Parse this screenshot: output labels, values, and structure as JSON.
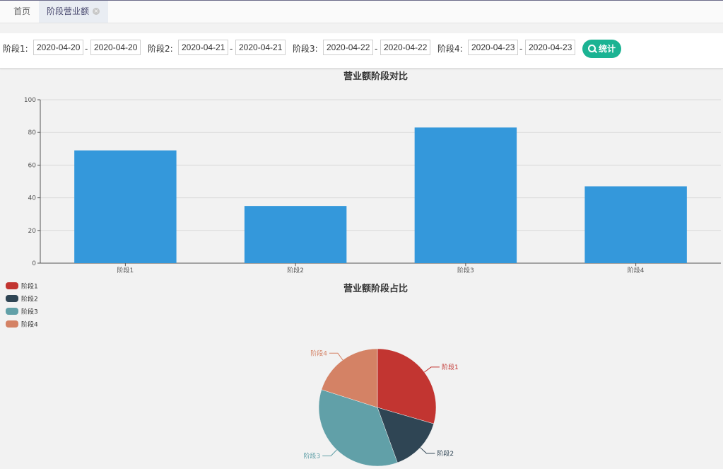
{
  "tabs": {
    "home": "首页",
    "active": "阶段营业额",
    "close_icon": "close-icon"
  },
  "filter": {
    "stages": [
      {
        "label": "阶段1:",
        "start": "2020-04-20",
        "end": "2020-04-20"
      },
      {
        "label": "阶段2:",
        "start": "2020-04-21",
        "end": "2020-04-21"
      },
      {
        "label": "阶段3:",
        "start": "2020-04-22",
        "end": "2020-04-22"
      },
      {
        "label": "阶段4:",
        "start": "2020-04-23",
        "end": "2020-04-23"
      }
    ],
    "separator": "-",
    "search_button": "统计",
    "search_icon": "search-icon"
  },
  "colors": {
    "bar": "#3498db",
    "accent": "#1bb393"
  },
  "chart_data": [
    {
      "type": "bar",
      "title": "营业额阶段对比",
      "categories": [
        "阶段1",
        "阶段2",
        "阶段3",
        "阶段4"
      ],
      "values": [
        69,
        35,
        83,
        47
      ],
      "ylim": [
        0,
        100
      ],
      "yticks": [
        0,
        20,
        40,
        60,
        80,
        100
      ],
      "grid": true,
      "xlabel": "",
      "ylabel": ""
    },
    {
      "type": "pie",
      "title": "营业额阶段占比",
      "categories": [
        "阶段1",
        "阶段2",
        "阶段3",
        "阶段4"
      ],
      "values": [
        69,
        35,
        83,
        47
      ],
      "colors": [
        "#c23531",
        "#2f4554",
        "#61a0a8",
        "#d48265"
      ],
      "legend_position": "top-left"
    }
  ]
}
